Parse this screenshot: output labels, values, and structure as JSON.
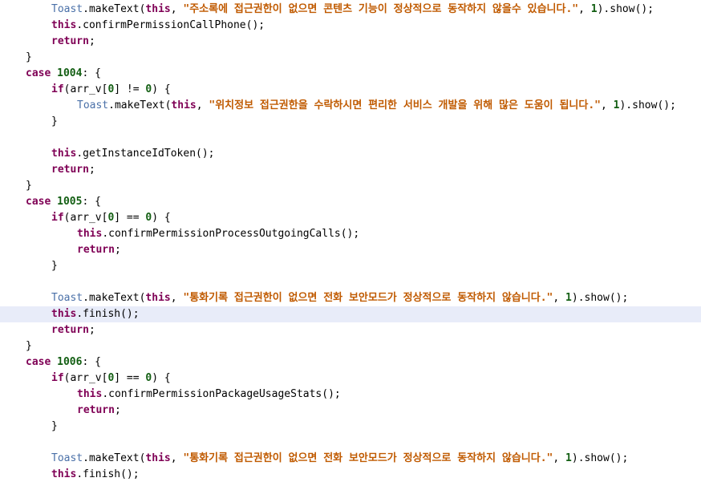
{
  "editor": {
    "highlighted_line": 20,
    "colors": {
      "keyword": "#7f0055",
      "string": "#c05a00",
      "number": "#125e12",
      "class": "#4a70a8",
      "plain": "#000000",
      "current_line_bg": "#e8ecf9",
      "background": "#ffffff"
    },
    "lines": [
      {
        "indent": 2,
        "tokens": [
          {
            "t": "cls",
            "v": "Toast"
          },
          {
            "t": "plain",
            "v": ".makeText("
          },
          {
            "t": "kw",
            "v": "this"
          },
          {
            "t": "plain",
            "v": ", "
          },
          {
            "t": "str",
            "v": "\"주소록에 접근권한이 없으면 콘텐츠 기능이 정상적으로 동작하지 않을수 있습니다.\""
          },
          {
            "t": "plain",
            "v": ", "
          },
          {
            "t": "num",
            "v": "1"
          },
          {
            "t": "plain",
            "v": ").show();"
          }
        ]
      },
      {
        "indent": 2,
        "tokens": [
          {
            "t": "kw",
            "v": "this"
          },
          {
            "t": "plain",
            "v": ".confirmPermissionCallPhone();"
          }
        ]
      },
      {
        "indent": 2,
        "tokens": [
          {
            "t": "kw",
            "v": "return"
          },
          {
            "t": "plain",
            "v": ";"
          }
        ]
      },
      {
        "indent": 1,
        "tokens": [
          {
            "t": "plain",
            "v": "}"
          }
        ]
      },
      {
        "indent": 1,
        "tokens": [
          {
            "t": "kw",
            "v": "case"
          },
          {
            "t": "plain",
            "v": " "
          },
          {
            "t": "num",
            "v": "1004"
          },
          {
            "t": "plain",
            "v": ": {"
          }
        ]
      },
      {
        "indent": 2,
        "tokens": [
          {
            "t": "kw",
            "v": "if"
          },
          {
            "t": "plain",
            "v": "(arr_v["
          },
          {
            "t": "num",
            "v": "0"
          },
          {
            "t": "plain",
            "v": "] != "
          },
          {
            "t": "num",
            "v": "0"
          },
          {
            "t": "plain",
            "v": ") {"
          }
        ]
      },
      {
        "indent": 3,
        "tokens": [
          {
            "t": "cls",
            "v": "Toast"
          },
          {
            "t": "plain",
            "v": ".makeText("
          },
          {
            "t": "kw",
            "v": "this"
          },
          {
            "t": "plain",
            "v": ", "
          },
          {
            "t": "str",
            "v": "\"위치정보 접근권한을 수락하시면 편리한 서비스 개발을 위해 많은 도움이 됩니다.\""
          },
          {
            "t": "plain",
            "v": ", "
          },
          {
            "t": "num",
            "v": "1"
          },
          {
            "t": "plain",
            "v": ").show();"
          }
        ]
      },
      {
        "indent": 2,
        "tokens": [
          {
            "t": "plain",
            "v": "}"
          }
        ]
      },
      {
        "indent": 0,
        "tokens": []
      },
      {
        "indent": 2,
        "tokens": [
          {
            "t": "kw",
            "v": "this"
          },
          {
            "t": "plain",
            "v": ".getInstanceIdToken();"
          }
        ]
      },
      {
        "indent": 2,
        "tokens": [
          {
            "t": "kw",
            "v": "return"
          },
          {
            "t": "plain",
            "v": ";"
          }
        ]
      },
      {
        "indent": 1,
        "tokens": [
          {
            "t": "plain",
            "v": "}"
          }
        ]
      },
      {
        "indent": 1,
        "tokens": [
          {
            "t": "kw",
            "v": "case"
          },
          {
            "t": "plain",
            "v": " "
          },
          {
            "t": "num",
            "v": "1005"
          },
          {
            "t": "plain",
            "v": ": {"
          }
        ]
      },
      {
        "indent": 2,
        "tokens": [
          {
            "t": "kw",
            "v": "if"
          },
          {
            "t": "plain",
            "v": "(arr_v["
          },
          {
            "t": "num",
            "v": "0"
          },
          {
            "t": "plain",
            "v": "] == "
          },
          {
            "t": "num",
            "v": "0"
          },
          {
            "t": "plain",
            "v": ") {"
          }
        ]
      },
      {
        "indent": 3,
        "tokens": [
          {
            "t": "kw",
            "v": "this"
          },
          {
            "t": "plain",
            "v": ".confirmPermissionProcessOutgoingCalls();"
          }
        ]
      },
      {
        "indent": 3,
        "tokens": [
          {
            "t": "kw",
            "v": "return"
          },
          {
            "t": "plain",
            "v": ";"
          }
        ]
      },
      {
        "indent": 2,
        "tokens": [
          {
            "t": "plain",
            "v": "}"
          }
        ]
      },
      {
        "indent": 0,
        "tokens": []
      },
      {
        "indent": 2,
        "tokens": [
          {
            "t": "cls",
            "v": "Toast"
          },
          {
            "t": "plain",
            "v": ".makeText("
          },
          {
            "t": "kw",
            "v": "this"
          },
          {
            "t": "plain",
            "v": ", "
          },
          {
            "t": "str",
            "v": "\"통화기록 접근권한이 없으면 전화 보안모드가 정상적으로 동작하지 않습니다.\""
          },
          {
            "t": "plain",
            "v": ", "
          },
          {
            "t": "num",
            "v": "1"
          },
          {
            "t": "plain",
            "v": ").show();"
          }
        ]
      },
      {
        "indent": 2,
        "tokens": [
          {
            "t": "kw",
            "v": "this"
          },
          {
            "t": "plain",
            "v": ".finish();"
          }
        ]
      },
      {
        "indent": 2,
        "tokens": [
          {
            "t": "kw",
            "v": "return"
          },
          {
            "t": "plain",
            "v": ";"
          }
        ]
      },
      {
        "indent": 1,
        "tokens": [
          {
            "t": "plain",
            "v": "}"
          }
        ]
      },
      {
        "indent": 1,
        "tokens": [
          {
            "t": "kw",
            "v": "case"
          },
          {
            "t": "plain",
            "v": " "
          },
          {
            "t": "num",
            "v": "1006"
          },
          {
            "t": "plain",
            "v": ": {"
          }
        ]
      },
      {
        "indent": 2,
        "tokens": [
          {
            "t": "kw",
            "v": "if"
          },
          {
            "t": "plain",
            "v": "(arr_v["
          },
          {
            "t": "num",
            "v": "0"
          },
          {
            "t": "plain",
            "v": "] == "
          },
          {
            "t": "num",
            "v": "0"
          },
          {
            "t": "plain",
            "v": ") {"
          }
        ]
      },
      {
        "indent": 3,
        "tokens": [
          {
            "t": "kw",
            "v": "this"
          },
          {
            "t": "plain",
            "v": ".confirmPermissionPackageUsageStats();"
          }
        ]
      },
      {
        "indent": 3,
        "tokens": [
          {
            "t": "kw",
            "v": "return"
          },
          {
            "t": "plain",
            "v": ";"
          }
        ]
      },
      {
        "indent": 2,
        "tokens": [
          {
            "t": "plain",
            "v": "}"
          }
        ]
      },
      {
        "indent": 0,
        "tokens": []
      },
      {
        "indent": 2,
        "tokens": [
          {
            "t": "cls",
            "v": "Toast"
          },
          {
            "t": "plain",
            "v": ".makeText("
          },
          {
            "t": "kw",
            "v": "this"
          },
          {
            "t": "plain",
            "v": ", "
          },
          {
            "t": "str",
            "v": "\"통화기록 접근권한이 없으면 전화 보안모드가 정상적으로 동작하지 않습니다.\""
          },
          {
            "t": "plain",
            "v": ", "
          },
          {
            "t": "num",
            "v": "1"
          },
          {
            "t": "plain",
            "v": ").show();"
          }
        ]
      },
      {
        "indent": 2,
        "tokens": [
          {
            "t": "kw",
            "v": "this"
          },
          {
            "t": "plain",
            "v": ".finish();"
          }
        ]
      }
    ]
  }
}
